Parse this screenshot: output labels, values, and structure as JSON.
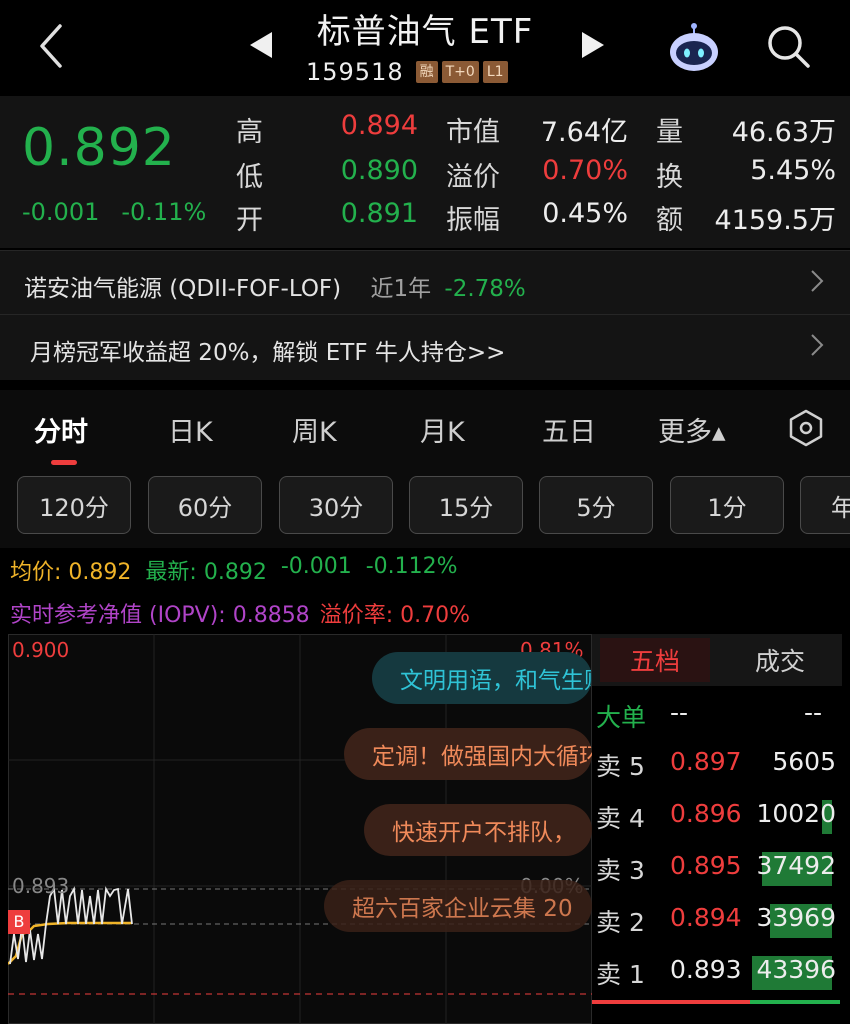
{
  "header": {
    "title": "标普油气 ETF",
    "code": "159518",
    "tags": [
      "融",
      "T+0",
      "L1"
    ],
    "icons": {
      "back": "chevron-left-icon",
      "prev": "triangle-left-icon",
      "next": "triangle-right-icon",
      "assistant": "robot-icon",
      "search": "search-icon"
    }
  },
  "quote": {
    "price": "0.892",
    "change": "-0.001",
    "change_pct": "-0.11%",
    "rows": [
      {
        "l1": "高",
        "v1": "0.894",
        "l2": "市值",
        "v2": "7.64亿",
        "l3": "量",
        "v3": "46.63万"
      },
      {
        "l1": "低",
        "v1": "0.890",
        "l2": "溢价",
        "v2": "0.70%",
        "l3": "换",
        "v3": "5.45%"
      },
      {
        "l1": "开",
        "v1": "0.891",
        "l2": "振幅",
        "v2": "0.45%",
        "l3": "额",
        "v3": "4159.5万"
      }
    ]
  },
  "fund_row": {
    "name": "诺安油气能源 (QDII-FOF-LOF)",
    "period": "近1年",
    "return": "-2.78%"
  },
  "promo_row": {
    "text": "月榜冠军收益超 20%，解锁 ETF 牛人持仓>>"
  },
  "tabs": [
    "分时",
    "日K",
    "周K",
    "月K",
    "五日",
    "更多▴"
  ],
  "periods": [
    "120分",
    "60分",
    "30分",
    "15分",
    "5分",
    "1分",
    "年"
  ],
  "stats": {
    "avg_label": "均价:",
    "avg": "0.892",
    "latest_label": "最新:",
    "latest": "0.892",
    "latest_chg": "-0.001",
    "latest_pct": "-0.112%",
    "iopv_label": "实时参考净值 (IOPV):",
    "iopv": "0.8858",
    "premium_label": "溢价率:",
    "premium": "0.70%"
  },
  "chart": {
    "y_top": "0.900",
    "y_top_pct": "0.81%",
    "y_mid": "0.893",
    "y_mid_pct": "0.00%",
    "buy_marker": "B",
    "news": [
      "文明用语，和气生财",
      "定调！做强国内大循环",
      "快速开户不排队，",
      "超六百家企业云集 20"
    ]
  },
  "order_book": {
    "tab_active": "五档",
    "tab_other": "成交",
    "big_label": "大单",
    "big_v1": "--",
    "big_v2": "--",
    "asks": [
      {
        "label": "卖 5",
        "price": "0.897",
        "vol": "5605",
        "fill": 0
      },
      {
        "label": "卖 4",
        "price": "0.896",
        "vol": "10020",
        "fill": 0.05
      },
      {
        "label": "卖 3",
        "price": "0.895",
        "vol": "37492",
        "fill": 0.35
      },
      {
        "label": "卖 2",
        "price": "0.894",
        "vol": "33969",
        "fill": 0.31
      },
      {
        "label": "卖 1",
        "price": "0.893",
        "vol": "43396",
        "fill": 0.4
      }
    ]
  },
  "colors": {
    "up": "#ee3d3d",
    "down": "#23b14d",
    "avg": "#f0b429",
    "iopv": "#b044c8"
  }
}
